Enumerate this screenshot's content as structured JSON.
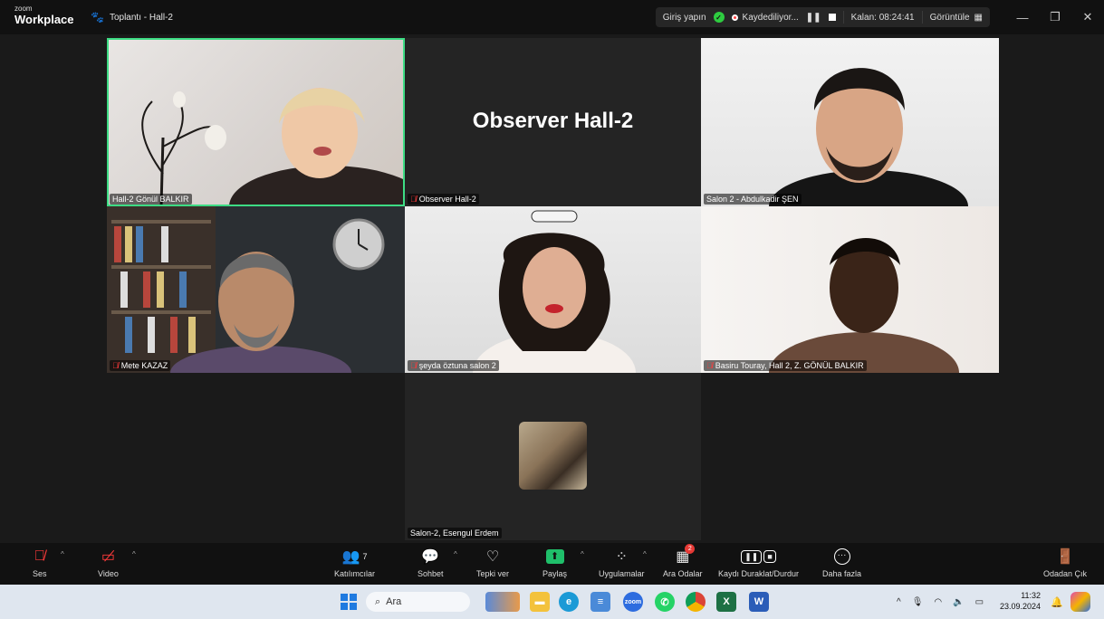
{
  "titlebar": {
    "logo_small": "zoom",
    "logo_big": "Workplace",
    "meeting_title": "Toplantı - Hall-2",
    "signin": "Giriş yapın",
    "recording": "Kaydediliyor...",
    "remaining": "Kalan: 08:24:41",
    "view": "Görüntüle"
  },
  "tiles": [
    {
      "name": "Hall-2 Gönül BALKIR",
      "muted": false,
      "active": true
    },
    {
      "name": "Observer Hall-2",
      "center_label": "Observer Hall-2",
      "muted": true
    },
    {
      "name": "Salon 2 - Abdulkadir ŞEN",
      "muted": false
    },
    {
      "name": "Mete KAZAZ",
      "muted": true
    },
    {
      "name": "şeyda öztuna salon 2",
      "muted": true
    },
    {
      "name": "Basiru Touray, Hall 2, Z. GÖNÜL BALKIR",
      "muted": true
    },
    {
      "name": "Salon-2, Esengul Erdem",
      "muted": false
    }
  ],
  "toolbar": {
    "audio": "Ses",
    "video": "Video",
    "participants": "Katılımcılar",
    "participants_count": "7",
    "chat": "Sohbet",
    "react": "Tepki ver",
    "share": "Paylaş",
    "apps": "Uygulamalar",
    "breakout": "Ara Odalar",
    "breakout_badge": "2",
    "record": "Kaydı Duraklat/Durdur",
    "more": "Daha fazla",
    "leave": "Odadan Çık"
  },
  "taskbar": {
    "search": "Ara",
    "time": "11:32",
    "date": "23.09.2024"
  },
  "colors": {
    "active_border": "#3ddc84",
    "share_green": "#1fbf6a",
    "mute_red": "#ff3b3b"
  }
}
